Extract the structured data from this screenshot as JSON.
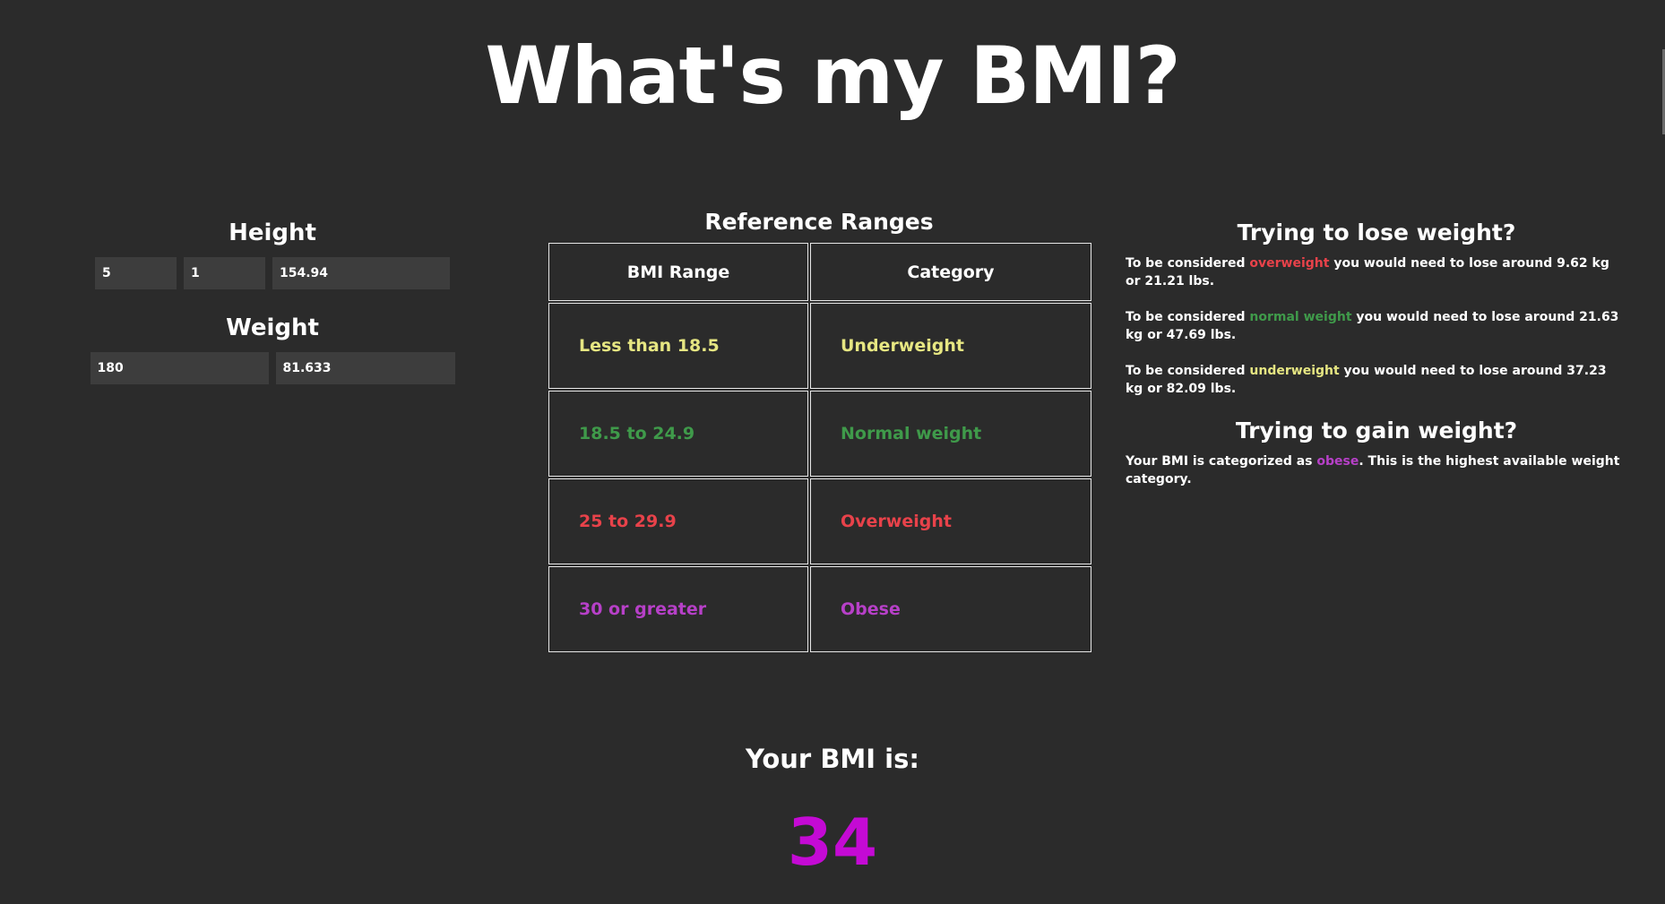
{
  "title": "What's my BMI?",
  "height": {
    "heading": "Height",
    "feet": "5",
    "inches": "1",
    "cm": "154.94"
  },
  "weight": {
    "heading": "Weight",
    "lbs": "180",
    "kg": "81.633"
  },
  "reference": {
    "title": "Reference Ranges",
    "header_range": "BMI Range",
    "header_category": "Category",
    "rows": [
      {
        "range": "Less than 18.5",
        "category": "Underweight",
        "color": "#e6e682"
      },
      {
        "range": "18.5 to 24.9",
        "category": "Normal weight",
        "color": "#3f9a4a"
      },
      {
        "range": "25 to 29.9",
        "category": "Overweight",
        "color": "#e8424a"
      },
      {
        "range": "30 or greater",
        "category": "Obese",
        "color": "#b740c8"
      }
    ]
  },
  "lose": {
    "heading": "Trying to lose weight?",
    "items": [
      {
        "prefix": "To be considered ",
        "category": "overweight",
        "color": "#e8424a",
        "suffix": " you would need to lose around 9.62 kg or 21.21 lbs."
      },
      {
        "prefix": "To be considered ",
        "category": "normal weight",
        "color": "#3f9a4a",
        "suffix": " you would need to lose around 21.63 kg or 47.69 lbs."
      },
      {
        "prefix": "To be considered ",
        "category": "underweight",
        "color": "#e6e682",
        "suffix": " you would need to lose around 37.23 kg or 82.09 lbs."
      }
    ]
  },
  "gain": {
    "heading": "Trying to gain weight?",
    "prefix": "Your BMI is categorized as ",
    "category": "obese",
    "color": "#b740c8",
    "suffix": ". This is the highest available weight category."
  },
  "result": {
    "label": "Your BMI is:",
    "value": "34",
    "color": "#c40ad4"
  }
}
